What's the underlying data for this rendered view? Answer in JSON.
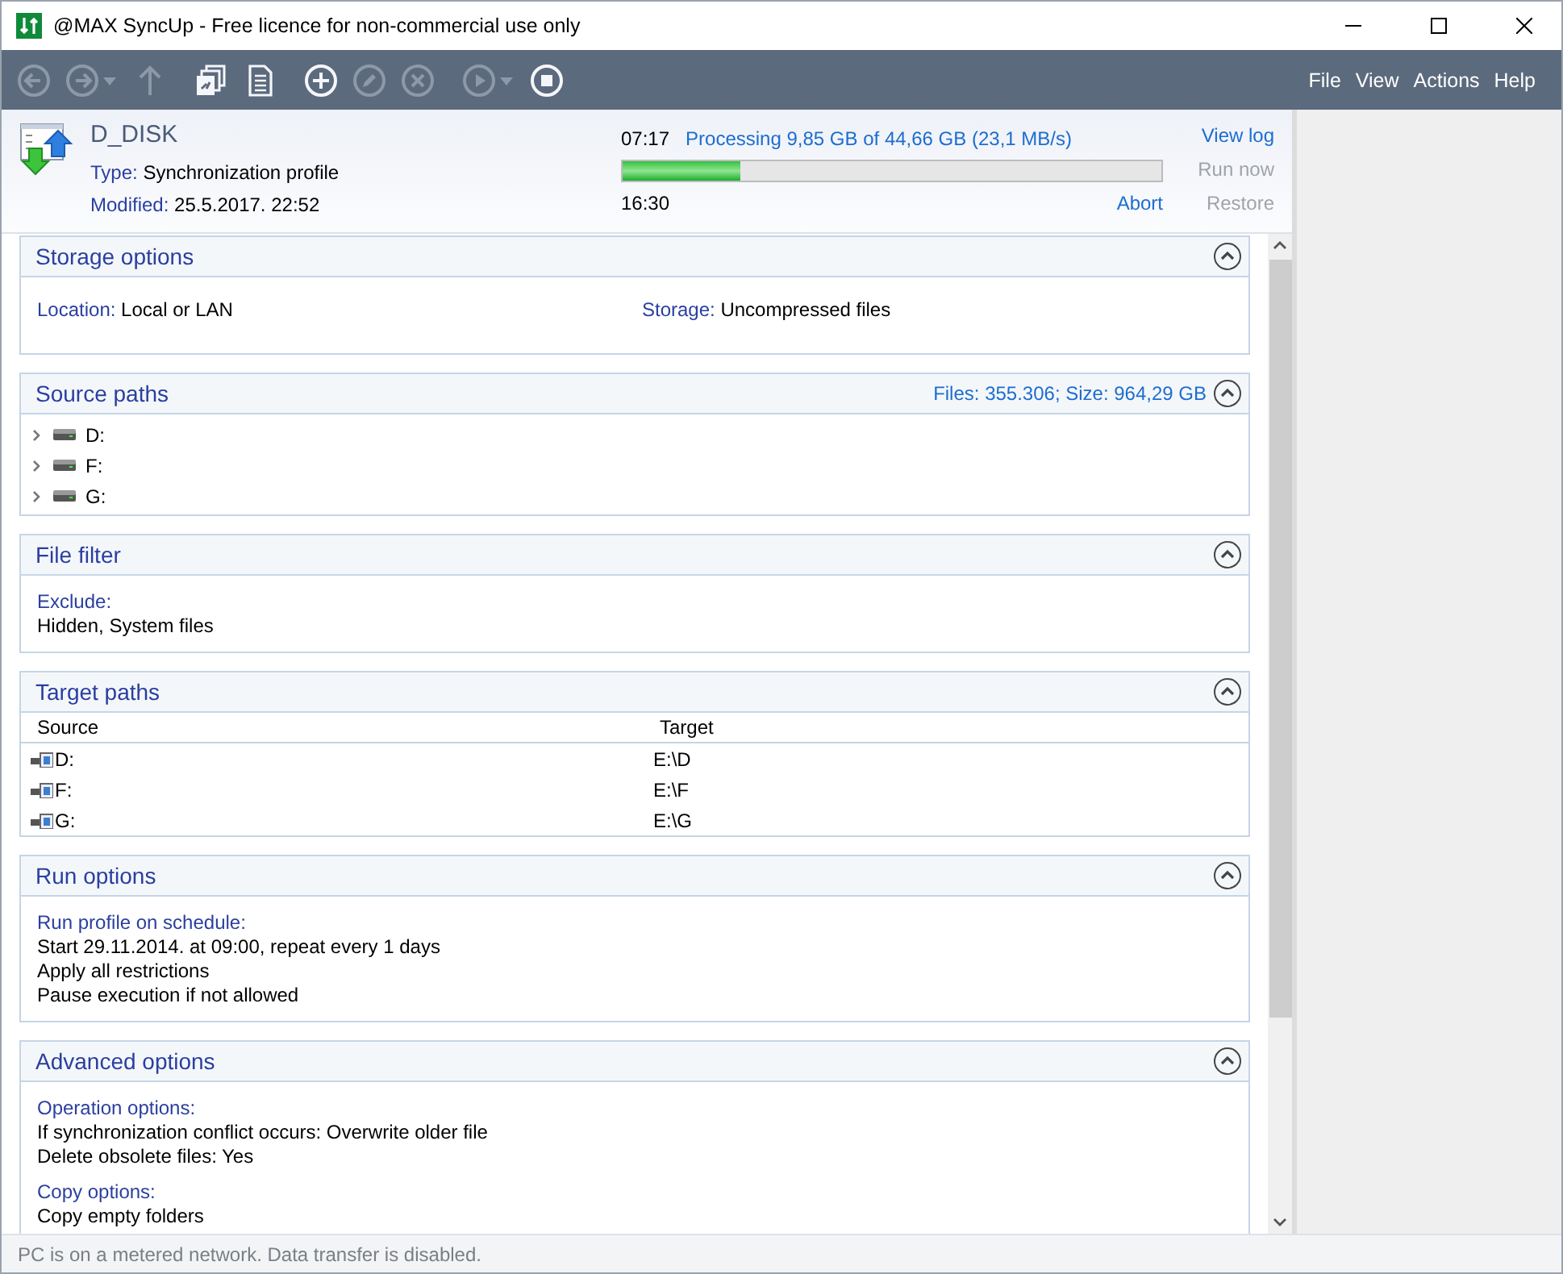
{
  "window": {
    "title": "@MAX SyncUp - Free licence for non-commercial use only"
  },
  "toolbar": {
    "buttons": [
      {
        "kind": "back",
        "disabled": true,
        "menu": false
      },
      {
        "kind": "forward",
        "disabled": true,
        "menu": true
      },
      {
        "kind": "up",
        "disabled": true,
        "menu": false
      },
      {
        "kind": "copy",
        "disabled": false,
        "menu": false
      },
      {
        "kind": "document",
        "disabled": false,
        "menu": false
      },
      {
        "kind": "add",
        "disabled": false,
        "menu": false
      },
      {
        "kind": "edit",
        "disabled": true,
        "menu": false
      },
      {
        "kind": "delete",
        "disabled": true,
        "menu": false
      },
      {
        "kind": "play",
        "disabled": true,
        "menu": true
      },
      {
        "kind": "stop",
        "disabled": false,
        "menu": false
      }
    ],
    "menu": [
      "File",
      "View",
      "Actions",
      "Help"
    ]
  },
  "profile": {
    "name": "D_DISK",
    "fields": [
      {
        "label": "Type:",
        "value": "Synchronization profile"
      },
      {
        "label": "Modified:",
        "value": "25.5.2017. 22:52"
      }
    ],
    "elapsed": "07:17",
    "status": "Processing 9,85 GB of 44,66 GB (23,1 MB/s)",
    "level": 0.22,
    "remaining": "16:30",
    "abort": {
      "label": "Abort",
      "disabled": false
    },
    "actions": [
      {
        "label": "View log",
        "disabled": false
      },
      {
        "label": "Run now",
        "disabled": true
      },
      {
        "label": "Restore",
        "disabled": true
      }
    ]
  },
  "sections": [
    {
      "title": "Storage options",
      "expanded": true,
      "kind": "fields",
      "fields": [
        {
          "label": "Location:",
          "value": "Local or LAN"
        },
        {
          "label": "Storage:",
          "value": "Uncompressed files"
        }
      ]
    },
    {
      "title": "Source paths",
      "expanded": true,
      "summary": "Files: 355.306; Size: 964,29 GB",
      "kind": "tree",
      "items": [
        {
          "label": "D:",
          "expanded": false
        },
        {
          "label": "F:",
          "expanded": false
        },
        {
          "label": "G:",
          "expanded": false
        }
      ]
    },
    {
      "title": "File filter",
      "expanded": true,
      "kind": "groups",
      "groups": [
        {
          "heading": "Exclude:",
          "lines": [
            "Hidden, System files"
          ]
        }
      ]
    },
    {
      "title": "Target paths",
      "expanded": true,
      "kind": "table",
      "columns": [
        "Source",
        "Target"
      ],
      "rows": [
        [
          "D:",
          "E:\\D"
        ],
        [
          "F:",
          "E:\\F"
        ],
        [
          "G:",
          "E:\\G"
        ]
      ]
    },
    {
      "title": "Run options",
      "expanded": true,
      "kind": "groups",
      "groups": [
        {
          "heading": "Run profile on schedule:",
          "lines": [
            "Start 29.11.2014. at 09:00, repeat every 1 days",
            "Apply all restrictions",
            "Pause execution if not allowed"
          ]
        }
      ]
    },
    {
      "title": "Advanced options",
      "expanded": true,
      "kind": "groups",
      "groups": [
        {
          "heading": "Operation options:",
          "lines": [
            "If synchronization conflict occurs: Overwrite older file",
            "Delete obsolete files: Yes"
          ]
        },
        {
          "heading": "Copy options:",
          "lines": [
            "Copy empty folders"
          ]
        }
      ]
    }
  ],
  "status_bar": "PC is on a metered network. Data transfer is disabled."
}
